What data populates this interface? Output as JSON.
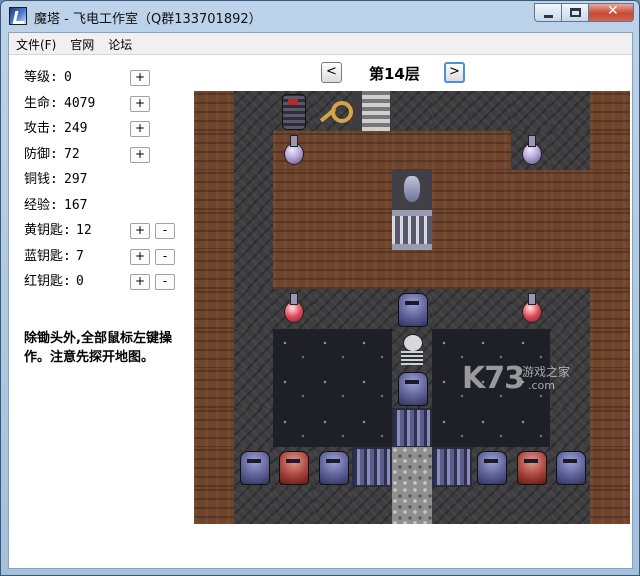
{
  "window": {
    "title": "魔塔 - 飞电工作室（Q群133701892）",
    "close_glyph": "✕"
  },
  "menu": [
    {
      "label": "文件(F)"
    },
    {
      "label": "官网"
    },
    {
      "label": "论坛"
    }
  ],
  "stats": [
    {
      "label": "等级:",
      "value": "0",
      "plus": "+",
      "minus": ""
    },
    {
      "label": "生命:",
      "value": "4079",
      "plus": "+",
      "minus": ""
    },
    {
      "label": "攻击:",
      "value": "249",
      "plus": "+",
      "minus": ""
    },
    {
      "label": "防御:",
      "value": "72",
      "plus": "+",
      "minus": ""
    },
    {
      "label": "铜钱:",
      "value": "297",
      "plus": "",
      "minus": ""
    },
    {
      "label": "经验:",
      "value": "167",
      "plus": "",
      "minus": ""
    },
    {
      "label": "黄钥匙:",
      "value": "12",
      "plus": "+",
      "minus": "-"
    },
    {
      "label": "蓝钥匙:",
      "value": "7",
      "plus": "+",
      "minus": "-"
    },
    {
      "label": "红钥匙:",
      "value": "0",
      "plus": "+",
      "minus": "-"
    }
  ],
  "hint": "除锄头外,全部鼠标左键操作。注意先探开地图。",
  "floor": {
    "label": "第14层",
    "prev": "<",
    "next": ">"
  },
  "watermark": {
    "logo": "K73",
    "site_cn": "游戏之家",
    "site_en": ".com"
  },
  "colors": {
    "title_bar": "#a5c0dc",
    "dirt": "#6e452c",
    "rock": "#3d3d3f",
    "accent": "#4a90d9"
  }
}
